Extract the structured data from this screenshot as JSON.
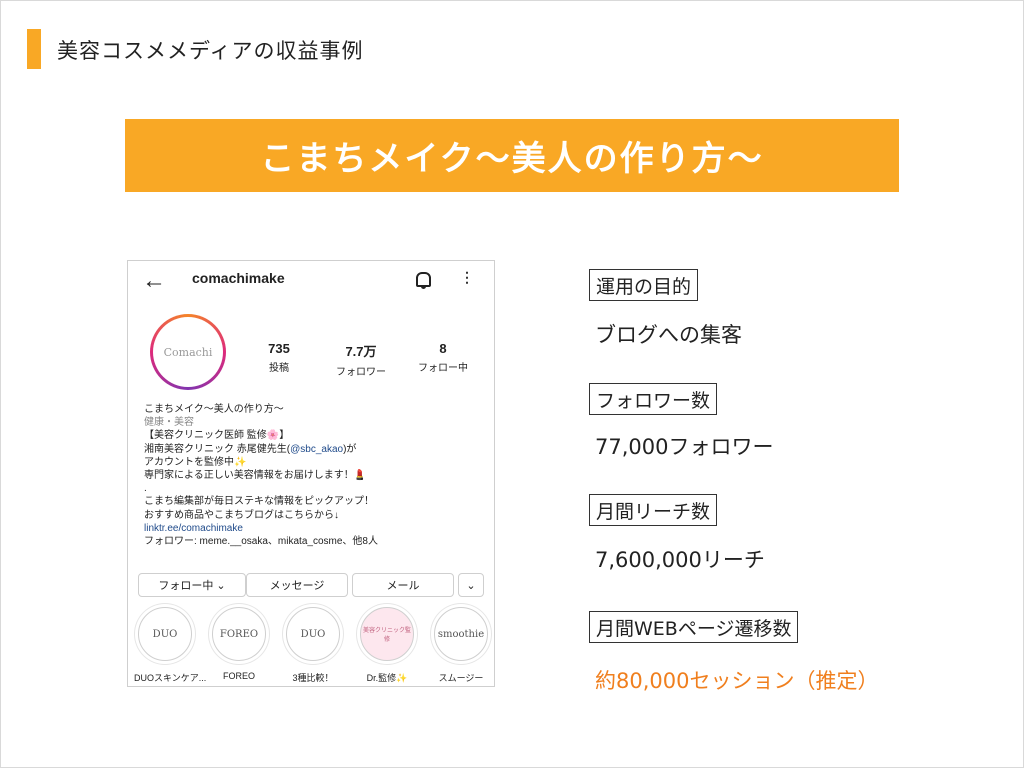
{
  "slide": {
    "title": "美容コスメメディアの収益事例",
    "banner": "こまちメイク〜美人の作り方〜"
  },
  "profile": {
    "username": "comachimake",
    "avatar_text": "Comachi",
    "stats": [
      {
        "number": "735",
        "label": "投稿"
      },
      {
        "number": "7.7万",
        "label": "フォロワー"
      },
      {
        "number": "8",
        "label": "フォロー中"
      }
    ],
    "bio": {
      "name": "こまちメイク〜美人の作り方〜",
      "category": "健康・美容",
      "line1": "【美容クリニック医師 監修🌸】",
      "line2_pre": "湘南美容クリニック 赤尾健先生(",
      "line2_handle": "@sbc_akao",
      "line2_post": ")が",
      "line3": "アカウントを監修中✨",
      "line4": "専門家による正しい美容情報をお届けします！💄",
      "line5": ".",
      "line6": "こまち編集部が毎日ステキな情報をピックアップ！",
      "line7": "おすすめ商品やこまちブログはこちらから↓",
      "link": "linktr.ee/comachimake",
      "followed_by": "フォロワー: meme.__osaka、mikata_cosme、他8人"
    },
    "buttons": {
      "following": "フォロー中 ⌄",
      "message": "メッセージ",
      "email": "メール",
      "more": "⌄"
    },
    "highlights": [
      {
        "cover": "DUO",
        "label": "DUOスキンケア..."
      },
      {
        "cover": "FOREO",
        "label": "FOREO"
      },
      {
        "cover": "DUO",
        "label": "3種比較！"
      },
      {
        "cover": "美容クリニック監修",
        "label": "Dr.監修✨"
      },
      {
        "cover": "smoothie",
        "label": "スムージー"
      }
    ]
  },
  "info": [
    {
      "label": "運用の目的",
      "value": "ブログへの集客"
    },
    {
      "label": "フォロワー数",
      "value": "77,000フォロワー"
    },
    {
      "label": "月間リーチ数",
      "value": "7,600,000リーチ"
    },
    {
      "label": "月間WEBページ遷移数",
      "value": "約80,000セッション（推定）"
    }
  ],
  "colors": {
    "accent": "#f9a825",
    "highlight_text": "#f07f1e"
  }
}
